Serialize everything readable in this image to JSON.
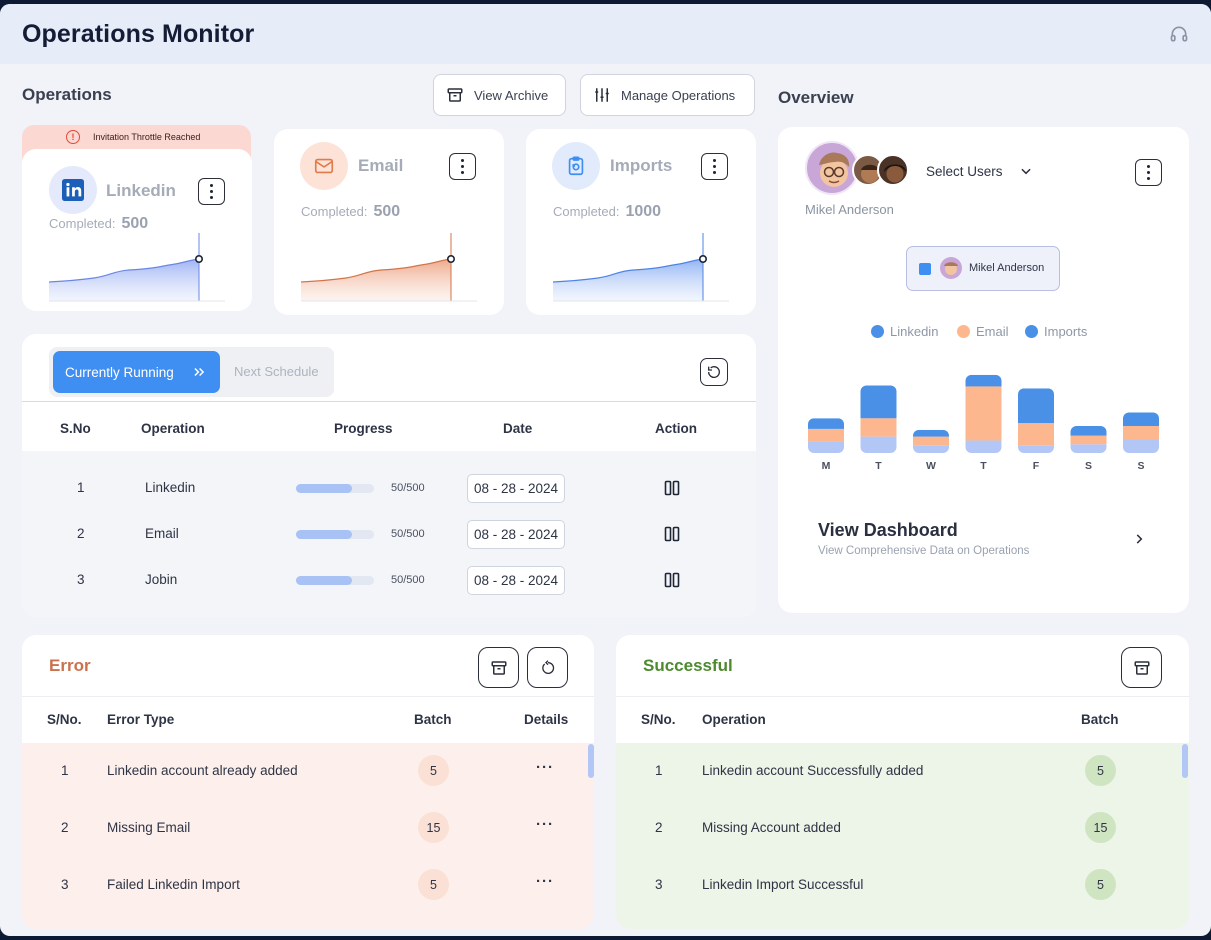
{
  "app": {
    "title": "Operations Monitor"
  },
  "operations": {
    "title": "Operations",
    "view_archive_label": "View Archive",
    "manage_operations_label": "Manage Operations",
    "warning_banner": "Invitation Throttle Reached",
    "completed_label": "Completed:",
    "cards": [
      {
        "name": "Linkedin",
        "completed": "500",
        "icon": "linkedin-icon",
        "color": "#4b63d6"
      },
      {
        "name": "Email",
        "completed": "500",
        "icon": "mail-icon",
        "color": "#e07b4c"
      },
      {
        "name": "Imports",
        "completed": "1000",
        "icon": "clipboard-icon",
        "color": "#3f8ef1"
      }
    ]
  },
  "schedule": {
    "tab_running": "Currently Running",
    "tab_next": "Next Schedule",
    "headers": {
      "sno": "S.No",
      "operation": "Operation",
      "progress": "Progress",
      "date": "Date",
      "action": "Action"
    },
    "rows": [
      {
        "sno": "1",
        "operation": "Linkedin",
        "progress_text": "50/500",
        "progress": 0.72,
        "date": "08 - 28 - 2024",
        "action_icon": "pause-icon"
      },
      {
        "sno": "2",
        "operation": "Email",
        "progress_text": "50/500",
        "progress": 0.72,
        "date": "08 - 28 - 2024",
        "action_icon": "pause-icon"
      },
      {
        "sno": "3",
        "operation": "Jobin",
        "progress_text": "50/500",
        "progress": 0.72,
        "date": "08 - 28 - 2024",
        "action_icon": "pause-icon"
      }
    ]
  },
  "overview": {
    "title": "Overview",
    "select_users_label": "Select Users",
    "selected_user": "Mikel Anderson",
    "chip_user": "Mikel Anderson",
    "view_dashboard_title": "View Dashboard",
    "view_dashboard_subtitle": "View Comprehensive Data on Operations"
  },
  "chart_data": {
    "type": "bar",
    "stacked": true,
    "categories": [
      "M",
      "T",
      "W",
      "T",
      "F",
      "S",
      "S"
    ],
    "series": [
      {
        "name": "Imports",
        "color": "#b3c7f6",
        "values": [
          12,
          17,
          8,
          13,
          8,
          9,
          14
        ]
      },
      {
        "name": "Email",
        "color": "#fdb78e",
        "values": [
          13,
          19,
          9,
          56,
          23,
          9,
          14
        ]
      },
      {
        "name": "Linkedin",
        "color": "#4a90e6",
        "values": [
          11,
          34,
          7,
          12,
          36,
          10,
          14
        ]
      }
    ],
    "legend": [
      "Linkedin",
      "Email",
      "Imports"
    ],
    "legend_colors": [
      "#4a90e6",
      "#fdb78e",
      "#4a90e6"
    ],
    "ylim": [
      0,
      85
    ],
    "grid": false,
    "legend_position": "top"
  },
  "errors": {
    "title": "Error",
    "headers": {
      "sno": "S/No.",
      "type": "Error Type",
      "batch": "Batch",
      "details": "Details"
    },
    "rows": [
      {
        "sno": "1",
        "type": "Linkedin account already added",
        "batch": "5",
        "details": "···"
      },
      {
        "sno": "2",
        "type": "Missing Email",
        "batch": "15",
        "details": "···"
      },
      {
        "sno": "3",
        "type": "Failed Linkedin Import",
        "batch": "5",
        "details": "···"
      }
    ]
  },
  "successful": {
    "title": "Successful",
    "headers": {
      "sno": "S/No.",
      "operation": "Operation",
      "batch": "Batch"
    },
    "rows": [
      {
        "sno": "1",
        "operation": "Linkedin account Successfully added",
        "batch": "5"
      },
      {
        "sno": "2",
        "operation": "Missing Account added",
        "batch": "15"
      },
      {
        "sno": "3",
        "operation": "Linkedin Import Successful",
        "batch": "5"
      }
    ]
  }
}
